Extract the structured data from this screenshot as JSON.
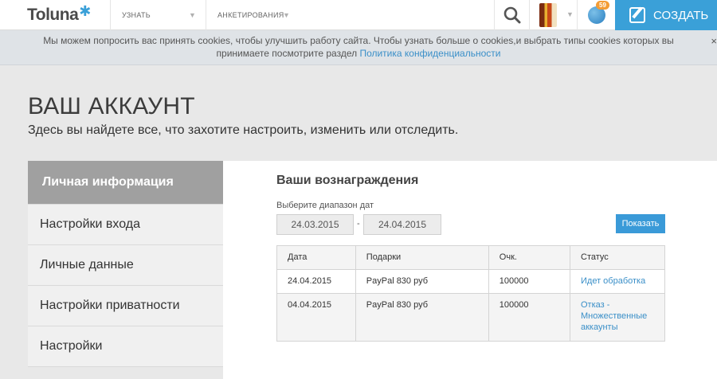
{
  "header": {
    "logo_text": "Toluna",
    "nav": [
      {
        "label": "УЗНАТЬ"
      },
      {
        "label": "АНКЕТИРОВАНИЯ"
      }
    ],
    "notifications_count": "59",
    "create_label": "СОЗДАТЬ",
    "icons": [
      "search-icon",
      "avatar",
      "globe-icon",
      "pencil-icon"
    ],
    "accent_color": "#3aa0d8",
    "badge_color": "#f39c35"
  },
  "cookie_notice": {
    "text_line1": "Мы можем попросить вас принять cookies, чтобы улучшить работу сайта. Чтобы узнать больше о cookies,и выбрать типы cookies которых вы",
    "text_line2_prefix": "принимаете посмотрите раздел ",
    "link_text": "Политика конфиденциальности",
    "close_label": "×"
  },
  "page": {
    "title": "ВАШ АККАУНТ",
    "subtitle": "Здесь вы найдете все, что захотите настроить, изменить или отследить."
  },
  "sidebar": {
    "items": [
      {
        "label": "Личная информация",
        "active": true
      },
      {
        "label": "Настройки входа"
      },
      {
        "label": "Личные данные"
      },
      {
        "label": "Настройки приватности"
      },
      {
        "label": "Настройки"
      }
    ]
  },
  "rewards": {
    "title": "Ваши вознаграждения",
    "range_label": "Выберите диапазон дат",
    "date_from": "24.03.2015",
    "date_separator": "-",
    "date_to": "24.04.2015",
    "show_button": "Показать",
    "columns": [
      "Дата",
      "Подарки",
      "Очк.",
      "Статус"
    ],
    "rows": [
      {
        "date": "24.04.2015",
        "gift": "PayPal 830 руб",
        "points": "100000",
        "status": "Идет обработка"
      },
      {
        "date": "04.04.2015",
        "gift": "PayPal 830 руб",
        "points": "100000",
        "status": "Отказ - Множественные аккаунты"
      }
    ]
  }
}
